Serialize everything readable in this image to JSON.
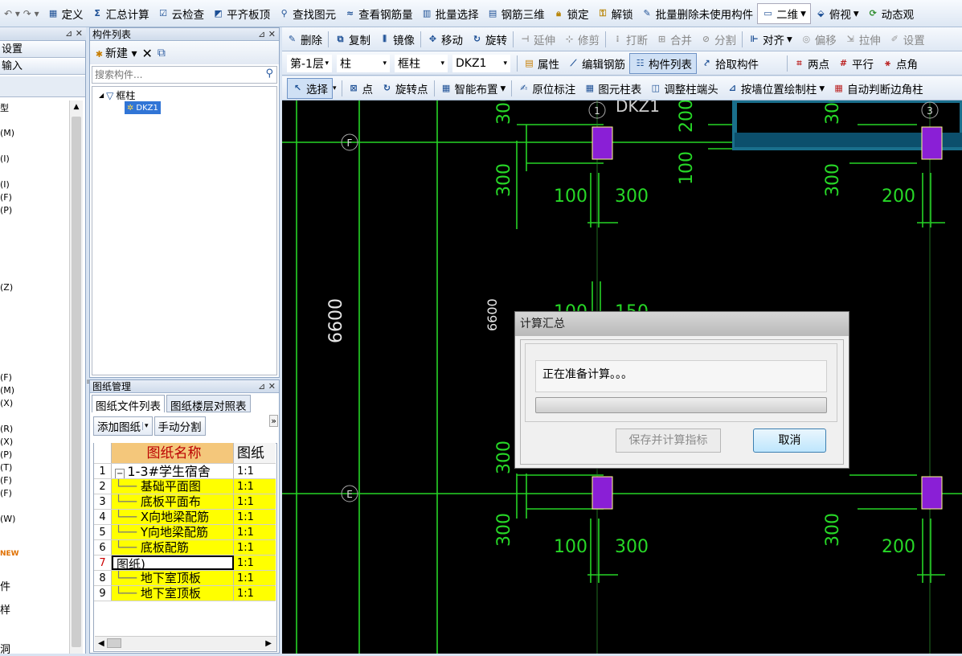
{
  "toolbar1": {
    "items": [
      "定义",
      "汇总计算",
      "云检查",
      "平齐板顶",
      "查找图元",
      "查看钢筋量",
      "批量选择",
      "钢筋三维",
      "锁定",
      "解锁",
      "批量删除未使用构件",
      "二维",
      "俯视",
      "动态观"
    ]
  },
  "left_panel": {
    "rows": [
      "设置",
      "输入"
    ],
    "labels": [
      "型",
      "(M)",
      "(I)",
      "(I)",
      "(F)",
      "(P)",
      "(Z)",
      "(F)",
      "(M)",
      "(X)",
      "(R)",
      "(X)",
      "(P)",
      "(T)",
      "(F)",
      "(F)",
      "(W)",
      "NEW",
      "件",
      "样",
      "洞"
    ]
  },
  "component_list": {
    "title": "构件列表",
    "new_label": "新建",
    "search_placeholder": "搜索构件...",
    "tree_root": "框柱",
    "tree_child": "DKZ1"
  },
  "drawing_mgmt": {
    "title": "图纸管理",
    "tab1": "图纸文件列表",
    "tab2": "图纸楼层对照表",
    "add_btn": "添加图纸",
    "split_btn": "手动分割",
    "col_name": "图纸名称",
    "col_page": "图纸",
    "rows": [
      {
        "num": "1",
        "name": "1-3#学生宿舍",
        "page": "1:1"
      },
      {
        "num": "2",
        "name": "基础平面图",
        "page": "1:1"
      },
      {
        "num": "3",
        "name": "底板平面布",
        "page": "1:1"
      },
      {
        "num": "4",
        "name": "X向地梁配筋",
        "page": "1:1"
      },
      {
        "num": "5",
        "name": "Y向地梁配筋",
        "page": "1:1"
      },
      {
        "num": "6",
        "name": "底板配筋",
        "page": "1:1"
      },
      {
        "num": "7",
        "name": "图纸)",
        "page": "1:1"
      },
      {
        "num": "8",
        "name": "地下室顶板",
        "page": "1:1"
      },
      {
        "num": "9",
        "name": "地下室顶板",
        "page": "1:1"
      }
    ]
  },
  "toolbar2": [
    "删除",
    "复制",
    "镜像",
    "移动",
    "旋转",
    "延伸",
    "修剪",
    "打断",
    "合并",
    "分割",
    "对齐",
    "偏移",
    "拉伸",
    "设置"
  ],
  "toolbar3": {
    "floor": "第-1层",
    "type1": "柱",
    "type2": "框柱",
    "comp": "DKZ1",
    "buttons": [
      "属性",
      "编辑钢筋",
      "构件列表",
      "拾取构件"
    ],
    "right": [
      "两点",
      "平行",
      "点角"
    ]
  },
  "toolbar4": [
    "选择",
    "点",
    "旋转点",
    "智能布置",
    "原位标注",
    "图元柱表",
    "调整柱端头",
    "按墙位置绘制柱",
    "自动判断边角柱"
  ],
  "canvas": {
    "labels": {
      "dkz1": "DKZ1",
      "axis1": "1",
      "axis3": "3",
      "axisF": "F",
      "axisE": "E",
      "d6600a": "6600",
      "d6600b": "6600",
      "d300": "300",
      "d200": "200",
      "d100": "100",
      "d150": "150"
    }
  },
  "dialog": {
    "title": "计算汇总",
    "message": "正在准备计算。。。",
    "progress": 0,
    "save_btn": "保存并计算指标",
    "cancel_btn": "取消"
  }
}
